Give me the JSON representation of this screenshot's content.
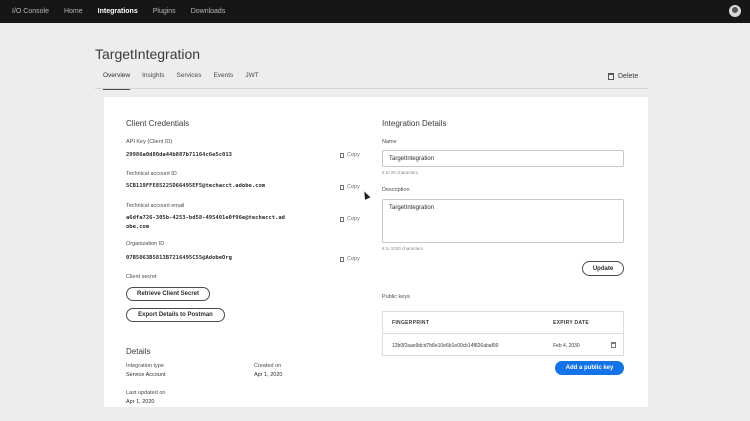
{
  "nav": {
    "brand": "I/O Console",
    "items": [
      "Home",
      "Integrations",
      "Plugins",
      "Downloads"
    ],
    "active": "Integrations"
  },
  "page": {
    "title": "TargetIntegration",
    "tabs": [
      "Overview",
      "Insights",
      "Services",
      "Events",
      "JWT"
    ],
    "active_tab": "Overview",
    "delete_label": "Delete"
  },
  "credentials": {
    "title": "Client Credentials",
    "api_key_label": "API Key (Client ID)",
    "api_key": "29986a0d80da44b887b71164c6e5c013",
    "tech_id_label": "Technical account ID",
    "tech_id": "5CB119FFE85225D66495EF5@techacct.adobe.com",
    "tech_email_label": "Technical account email",
    "tech_email_line1": "a6dfa726-305b-4253-bd58-495401e0f96e@techacct.ad",
    "tech_email_line2": "obe.com",
    "org_id_label": "Organization ID",
    "org_id": "07B5063B5813B7216495C55@AdobeOrg",
    "copy_label": "Copy",
    "client_secret_label": "Client secret",
    "retrieve_button": "Retrieve Client Secret",
    "export_button": "Export Details to Postman"
  },
  "details": {
    "title": "Details",
    "integration_type_label": "Integration type",
    "integration_type": "Service Account",
    "created_label": "Created on",
    "created": "Apr 1, 2020",
    "updated_label": "Last updated on",
    "updated": "Apr 1, 2020"
  },
  "integration": {
    "title": "Integration Details",
    "name_label": "Name",
    "name_value": "TargetIntegration",
    "name_hint": "6 to 25 characters",
    "description_label": "Description",
    "description_value": "TargetIntegration",
    "description_hint": "6 to 1000 characters",
    "update_button": "Update"
  },
  "public_keys": {
    "title": "Public keys",
    "columns": [
      "FINGERPRINT",
      "EXPIRY DATE"
    ],
    "rows": [
      {
        "fingerprint": "12b0f2aae9dcd7b8e10e6b1e00cb14f826abaf90",
        "expiry": "Feb 4, 2030"
      }
    ],
    "add_button": "Add a public key"
  }
}
